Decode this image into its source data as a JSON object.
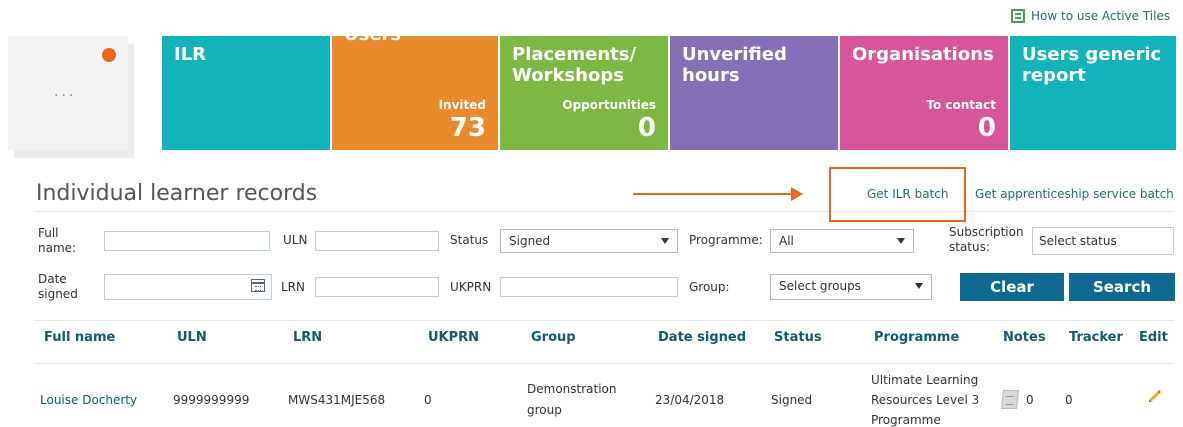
{
  "help_link": "How to use Active Tiles",
  "tiles": [
    {
      "title": "ILR",
      "sub": "",
      "value": ""
    },
    {
      "title": "Users",
      "sub": "Invited",
      "value": "73"
    },
    {
      "title": "Placements/ Workshops",
      "sub": "Opportunities",
      "value": "0"
    },
    {
      "title": "Unverified hours",
      "sub": "",
      "value": ""
    },
    {
      "title": "Organisations",
      "sub": "To contact",
      "value": "0"
    },
    {
      "title": "Users generic report",
      "sub": "",
      "value": ""
    }
  ],
  "more_tile": {
    "label": "..."
  },
  "page_title": "Individual learner records",
  "links": {
    "get_ilr_batch": "Get ILR batch",
    "get_apprenticeship": "Get apprenticeship service batch"
  },
  "filters": {
    "full_name_label": "Full name:",
    "uln_label": "ULN",
    "status_label": "Status",
    "status_value": "Signed",
    "programme_label": "Programme:",
    "programme_value": "All",
    "subscription_label": "Subscription status:",
    "subscription_value": "Select status",
    "date_signed_label": "Date signed",
    "lrn_label": "LRN",
    "ukprn_label": "UKPRN",
    "group_label": "Group:",
    "group_value": "Select groups"
  },
  "buttons": {
    "clear": "Clear",
    "search": "Search"
  },
  "table": {
    "headers": [
      "Full name",
      "ULN",
      "LRN",
      "UKPRN",
      "Group",
      "Date signed",
      "Status",
      "Programme",
      "Notes",
      "Tracker",
      "Edit"
    ],
    "rows": [
      {
        "full_name": "Louise Docherty",
        "uln": "9999999999",
        "lrn": "MWS431MJE568",
        "ukprn": "0",
        "group_line1": "Demonstration",
        "group_line2": "group",
        "date_signed": "23/04/2018",
        "status": "Signed",
        "programme_line1": "Ultimate Learning",
        "programme_line2": "Resources Level 3",
        "programme_line3": "Programme",
        "notes": "0",
        "tracker": "0"
      }
    ]
  },
  "colors": {
    "teal": "#12b3ba",
    "orange": "#e98a2c",
    "green": "#7cb843",
    "purple": "#8570b8",
    "pink": "#d8559a",
    "button_blue": "#0e6a92",
    "highlight_orange": "#e8681c"
  },
  "icons": [
    "film-icon",
    "calendar-icon",
    "notes-icon",
    "pencil-icon",
    "dropdown-caret-icon"
  ]
}
